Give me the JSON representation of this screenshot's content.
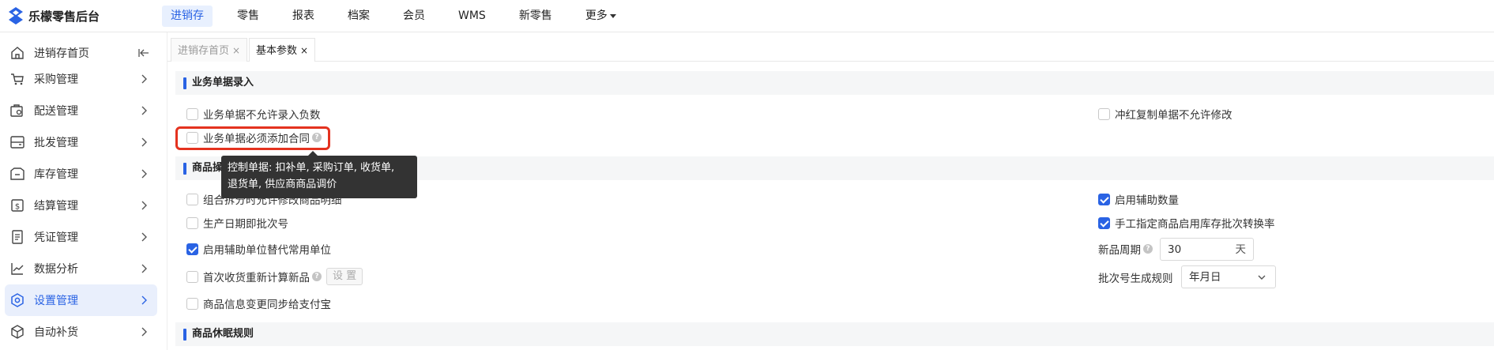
{
  "app": {
    "title": "乐檬零售后台",
    "accent_color": "#2a63e4"
  },
  "top_nav": {
    "items": [
      "进销存",
      "零售",
      "报表",
      "档案",
      "会员",
      "WMS",
      "新零售",
      "更多"
    ],
    "active": "进销存"
  },
  "sidebar": {
    "items": [
      {
        "label": "进销存首页",
        "icon": "home-icon"
      },
      {
        "label": "采购管理",
        "icon": "cart-icon"
      },
      {
        "label": "配送管理",
        "icon": "delivery-icon"
      },
      {
        "label": "批发管理",
        "icon": "wholesale-icon"
      },
      {
        "label": "库存管理",
        "icon": "inventory-icon"
      },
      {
        "label": "结算管理",
        "icon": "settlement-icon"
      },
      {
        "label": "凭证管理",
        "icon": "voucher-icon"
      },
      {
        "label": "数据分析",
        "icon": "chart-icon"
      },
      {
        "label": "设置管理",
        "icon": "settings-icon",
        "active": true
      },
      {
        "label": "自动补货",
        "icon": "replenish-icon"
      }
    ]
  },
  "tabs": [
    {
      "label": "进销存首页",
      "close": "×"
    },
    {
      "label": "基本参数",
      "close": "×",
      "active": true
    }
  ],
  "sections": {
    "business_entry": "业务单据录入",
    "product": "商品操作",
    "dormant": "商品休眠规则"
  },
  "options": {
    "no_negative": {
      "label": "业务单据不允许录入负数",
      "checked": false
    },
    "red_copy": {
      "label": "冲红复制单据不允许修改",
      "checked": false
    },
    "must_contract": {
      "label": "业务单据必须添加合同",
      "checked": false
    },
    "combo_split": {
      "label": "组合拆分时允许修改商品明细",
      "checked": false
    },
    "aux_qty": {
      "label": "启用辅助数量",
      "checked": true
    },
    "prod_date_batch": {
      "label": "生产日期即批次号",
      "checked": false
    },
    "manual_batch": {
      "label": "手工指定商品启用库存批次转换率",
      "checked": true
    },
    "aux_unit": {
      "label": "启用辅助单位替代常用单位",
      "checked": true
    },
    "first_receive": {
      "label": "首次收货重新计算新品",
      "checked": false
    },
    "sync_alipay": {
      "label": "商品信息变更同步给支付宝",
      "checked": false
    }
  },
  "settings_button": "设 置",
  "tooltip": {
    "line1": "控制单据: 扣补单, 采购订单, 收货单,",
    "line2": "退货单, 供应商商品调价"
  },
  "new_product_period": {
    "label": "新品周期",
    "value": "30",
    "unit": "天"
  },
  "batch_rule": {
    "label": "批次号生成规则",
    "value": "年月日"
  }
}
